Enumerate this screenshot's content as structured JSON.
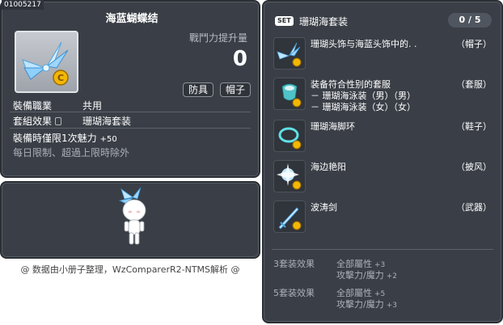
{
  "item_id": "01005217",
  "item": {
    "title": "海蓝蝴蝶结",
    "power_label": "戰鬥力提升量",
    "power_value": "0",
    "tags": [
      "防具",
      "帽子"
    ],
    "job_label": "裝備職業",
    "job_value": "共用",
    "set_label": "套組效果",
    "set_value": "珊瑚海套装",
    "charm_text": "裝備時僅限1次魅力",
    "charm_bonus": "+50",
    "limit_text": "每日限制、超過上限時除外"
  },
  "set": {
    "badge": "SET",
    "name": "珊瑚海套装",
    "count": "0 / 5",
    "pieces": [
      {
        "name": "珊瑚头饰与海蓝头饰中的. .",
        "slot": "（帽子）",
        "sub": [],
        "icon": "ribbon-icon"
      },
      {
        "name": "装备符合性别的套服",
        "slot": "（套服）",
        "sub": [
          "－ 珊瑚海泳装（男）（男）",
          "－ 珊瑚海泳装（女）（女）"
        ],
        "icon": "swimsuit-icon"
      },
      {
        "name": "珊瑚海脚环",
        "slot": "（鞋子）",
        "sub": [],
        "icon": "anklet-icon"
      },
      {
        "name": "海边艳阳",
        "slot": "（披风）",
        "sub": [],
        "icon": "sun-cape-icon"
      },
      {
        "name": "波涛剑",
        "slot": "（武器）",
        "sub": [],
        "icon": "sword-icon"
      }
    ],
    "effects": [
      {
        "label": "3套装效果",
        "lines": [
          {
            "text": "全部屬性",
            "val": "+3"
          },
          {
            "text": "攻擊力/魔力",
            "val": "+2"
          }
        ]
      },
      {
        "label": "5套装效果",
        "lines": [
          {
            "text": "全部屬性",
            "val": "+5"
          },
          {
            "text": "攻擊力/魔力",
            "val": "+3"
          }
        ]
      }
    ]
  },
  "credit": "@ 数据由小册子整理，WzComparerR2-NTMS解析 @",
  "colors": {
    "panel": "#3a3f47",
    "gem": "#7ec9f5",
    "coin": "#f2b705"
  }
}
